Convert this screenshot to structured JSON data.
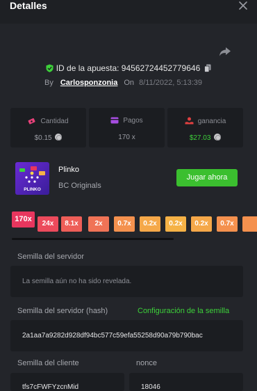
{
  "header": {
    "title": "Detalles"
  },
  "bet": {
    "id_label": "ID de la apuesta:",
    "id_value": "94562724452779646",
    "by_label": "By",
    "username": "Carlosponzonia",
    "on_label": "On",
    "date": "8/11/2022, 5:13:39"
  },
  "stats": [
    {
      "label": "Cantidad",
      "value": "$0.15",
      "icon": "money-icon",
      "color": "#e8417a"
    },
    {
      "label": "Pagos",
      "value": "170 x",
      "icon": "wallet-icon",
      "color": "#a64de0"
    },
    {
      "label": "ganancia",
      "value": "$27.03",
      "icon": "profit-icon",
      "color": "#e04040"
    }
  ],
  "game": {
    "name": "Plinko",
    "provider": "BC Originals",
    "play_label": "Jugar ahora",
    "thumb_text": "PLINKO"
  },
  "multipliers": [
    {
      "label": "170x",
      "color": "#e8365e"
    },
    {
      "label": "24x",
      "color": "#ec4a5c"
    },
    {
      "label": "8.1x",
      "color": "#ee5e58"
    },
    {
      "label": "2x",
      "color": "#f07356"
    },
    {
      "label": "0.7x",
      "color": "#f4914e"
    },
    {
      "label": "0.2x",
      "color": "#f5a849"
    },
    {
      "label": "0.2x",
      "color": "#f5b246"
    },
    {
      "label": "0.2x",
      "color": "#f5a849"
    },
    {
      "label": "0.7x",
      "color": "#f4914e"
    },
    {
      "label": "",
      "color": "#f4914e"
    }
  ],
  "seeds": {
    "server_label": "Semilla del servidor",
    "server_value": "La semilla aún no ha sido revelada.",
    "server_hash_label": "Semilla del servidor (hash)",
    "seed_settings_link": "Configuración de la semilla",
    "server_hash_value": "2a1aa7a9282d928df94bc577c59efa55258d90a79b790bac",
    "client_label": "Semilla del cliente",
    "client_value": "tfs7cFWFYzcnMid",
    "nonce_label": "nonce",
    "nonce_value": "18046"
  },
  "colors": {
    "accent_green": "#3bbf2f",
    "background": "#23252a",
    "card": "#1b1d21"
  }
}
